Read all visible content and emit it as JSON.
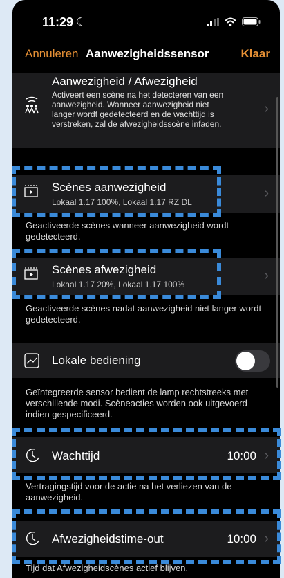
{
  "status": {
    "time": "11:29"
  },
  "nav": {
    "cancel": "Annuleren",
    "title": "Aanwezigheidssensor",
    "done": "Klaar"
  },
  "presence": {
    "title": "Aanwezigheid / Afwezigheid",
    "desc": "Activeert een scène na het detecteren van een aanwezigheid. Wanneer aanwezigheid niet langer wordt gedetecteerd en de wachttijd is verstreken, zal de afwezigheidsscène infaden."
  },
  "scenes_presence": {
    "label": "Scènes aanwezigheid",
    "sub": "Lokaal 1.17 100%, Lokaal 1.17 RZ DL",
    "caption": "Geactiveerde scènes wanneer aanwezigheid wordt gedetecteerd."
  },
  "scenes_absence": {
    "label": "Scènes afwezigheid",
    "sub": "Lokaal 1.17 20%, Lokaal 1.17 100%",
    "caption": "Geactiveerde scènes nadat aanwezigheid niet langer wordt gedetecteerd."
  },
  "local_control": {
    "label": "Lokale bediening",
    "caption": "Geïntegreerde sensor bedient de lamp rechtstreeks met verschillende modi. Scèneacties worden ook uitgevoerd indien gespecificeerd.",
    "toggle_on": false
  },
  "wait_time": {
    "label": "Wachttijd",
    "value": "10:00",
    "caption": "Vertragingstijd voor de actie na het verliezen van de aanwezigheid."
  },
  "absence_timeout": {
    "label": "Afwezigheidstime-out",
    "value": "10:00",
    "caption": "Tijd dat Afwezigheidscènes actief blijven."
  },
  "colors": {
    "accent": "#e69035",
    "highlight": "#3a8ad9",
    "card": "#1c1c1e"
  }
}
